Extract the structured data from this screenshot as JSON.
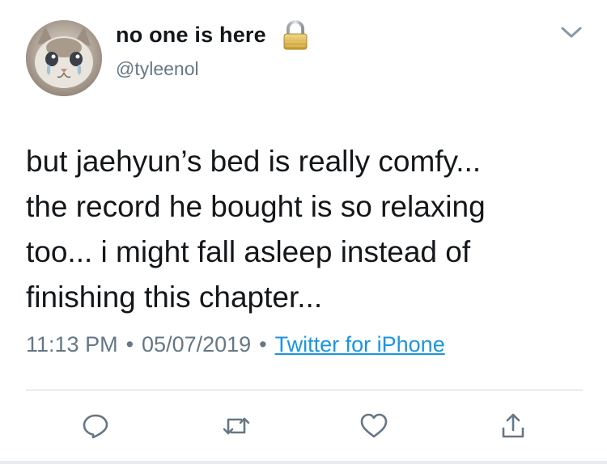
{
  "user": {
    "display_name": "no one is here",
    "handle": "@tyleenol",
    "avatar_icon": "crying-cat-avatar",
    "protected_icon": "lock-icon"
  },
  "tweet": {
    "lines": [
      "but jaehyun’s bed is really comfy...",
      "the record he bought is so relaxing",
      "too... i might fall asleep instead of",
      "finishing this chapter..."
    ]
  },
  "meta": {
    "time": "11:13 PM",
    "separator": "•",
    "date": "05/07/2019",
    "source": "Twitter for iPhone"
  },
  "actions": {
    "reply_icon": "reply-icon",
    "retweet_icon": "retweet-icon",
    "like_icon": "heart-icon",
    "share_icon": "share-icon"
  },
  "colors": {
    "text": "#14171a",
    "secondary": "#657786",
    "link": "#1b95e0",
    "icon": "#657786",
    "divider": "#ccd6dd"
  }
}
